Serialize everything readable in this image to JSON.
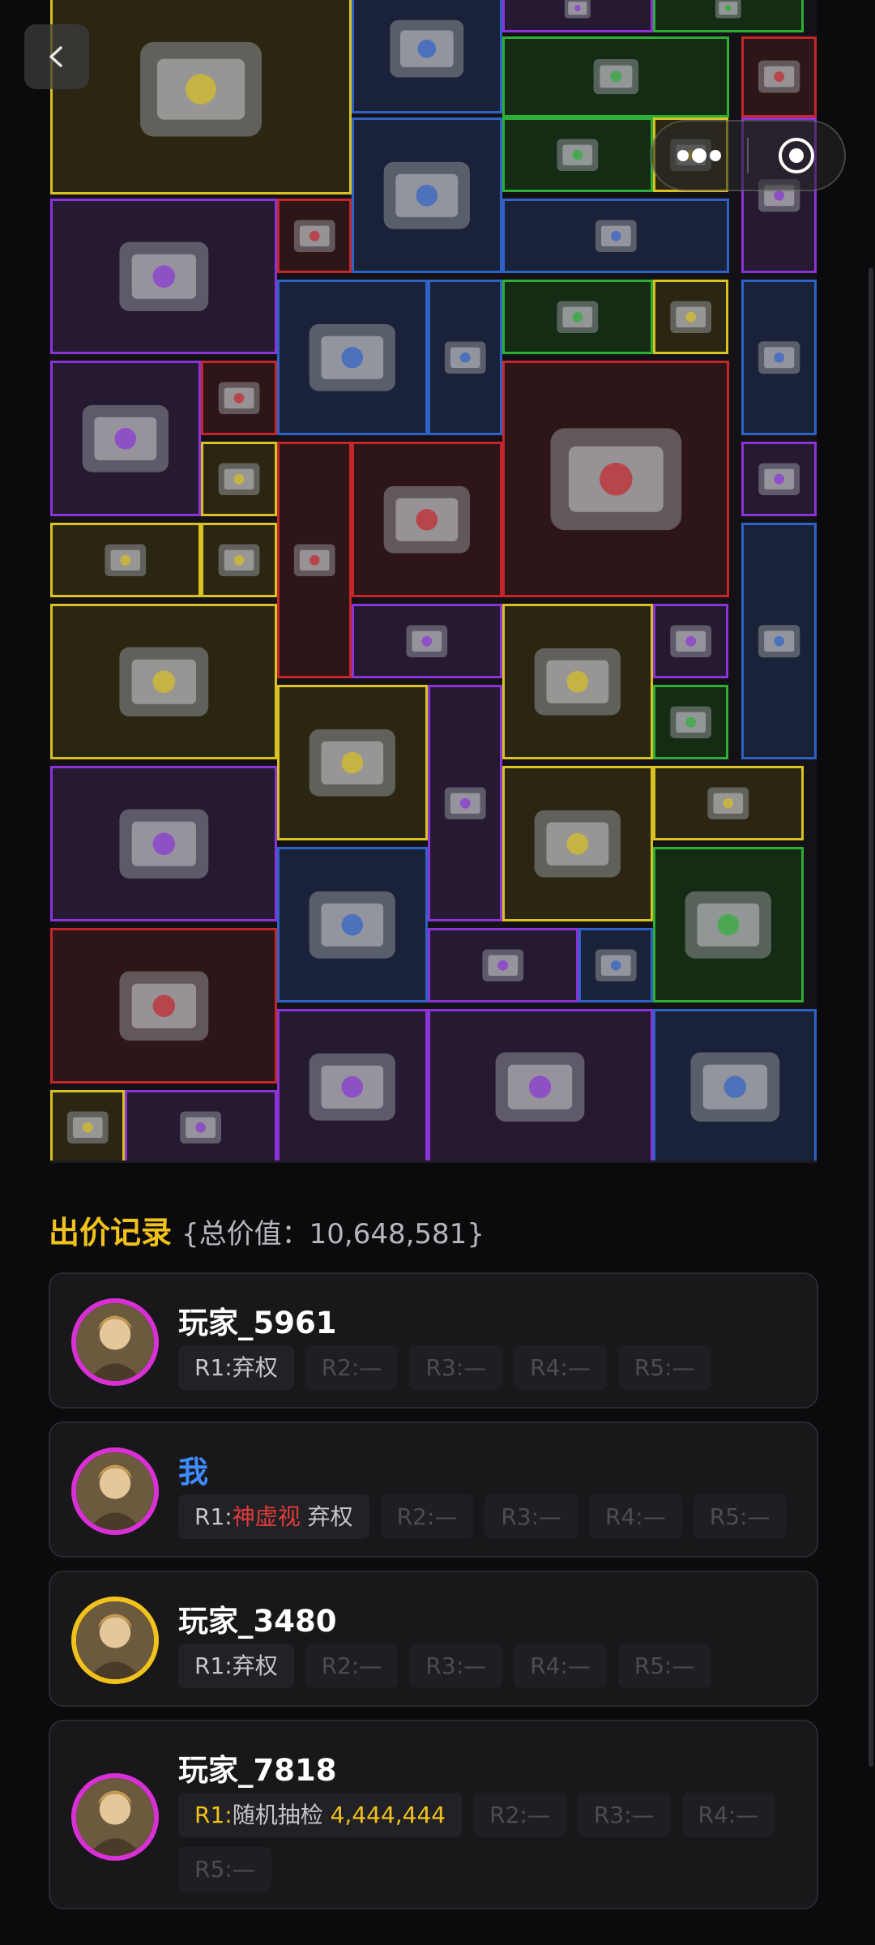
{
  "bid_section": {
    "title": "出价记录",
    "total_label": "{总价值：10,648,581}"
  },
  "records": [
    {
      "name": "玩家_5961",
      "name_color": "#ffffff",
      "avatar_ring": "#d930d6",
      "rounds": [
        {
          "label": "R1:",
          "text": "弃权",
          "dim": false
        },
        {
          "label": "R2:",
          "text": "—",
          "dim": true
        },
        {
          "label": "R3:",
          "text": "—",
          "dim": true
        },
        {
          "label": "R4:",
          "text": "—",
          "dim": true
        },
        {
          "label": "R5:",
          "text": "—",
          "dim": true
        }
      ]
    },
    {
      "name": "我",
      "name_color": "#3f8cff",
      "avatar_ring": "#d930d6",
      "rounds": [
        {
          "label": "R1:",
          "tool": "神虚视",
          "text": " 弃权",
          "dim": false
        },
        {
          "label": "R2:",
          "text": "—",
          "dim": true
        },
        {
          "label": "R3:",
          "text": "—",
          "dim": true
        },
        {
          "label": "R4:",
          "text": "—",
          "dim": true
        },
        {
          "label": "R5:",
          "text": "—",
          "dim": true
        }
      ]
    },
    {
      "name": "玩家_3480",
      "name_color": "#ffffff",
      "avatar_ring": "#f1c21b",
      "rounds": [
        {
          "label": "R1:",
          "text": "弃权",
          "dim": false
        },
        {
          "label": "R2:",
          "text": "—",
          "dim": true
        },
        {
          "label": "R3:",
          "text": "—",
          "dim": true
        },
        {
          "label": "R4:",
          "text": "—",
          "dim": true
        },
        {
          "label": "R5:",
          "text": "—",
          "dim": true
        }
      ]
    },
    {
      "name": "玩家_7818",
      "name_color": "#ffffff",
      "avatar_ring": "#d930d6",
      "rounds": [
        {
          "label": "R1:",
          "text": "随机抽检 ",
          "amount": "4,444,444",
          "dim": false,
          "gold_label": true
        },
        {
          "label": "R2:",
          "text": "—",
          "dim": true
        },
        {
          "label": "R3:",
          "text": "—",
          "dim": true
        },
        {
          "label": "R4:",
          "text": "—",
          "dim": true
        },
        {
          "label": "R5:",
          "text": "—",
          "dim": true
        }
      ]
    }
  ],
  "items": [
    {
      "name": "server-rack",
      "rarity": "gold"
    },
    {
      "name": "paint-can",
      "rarity": "blue"
    },
    {
      "name": "edc-kit-top",
      "rarity": "purple"
    },
    {
      "name": "cloth-item-top",
      "rarity": "green"
    },
    {
      "name": "sledgehammer",
      "rarity": "green"
    },
    {
      "name": "compass",
      "rarity": "red"
    },
    {
      "name": "power-drill",
      "rarity": "blue"
    },
    {
      "name": "old-map",
      "rarity": "green"
    },
    {
      "name": "hex-gadget",
      "rarity": "gold"
    },
    {
      "name": "hookah-vase",
      "rarity": "purple"
    },
    {
      "name": "hunting-knife",
      "rarity": "purple"
    },
    {
      "name": "usb-drive",
      "rarity": "red"
    },
    {
      "name": "hacksaw",
      "rarity": "blue"
    },
    {
      "name": "magazine",
      "rarity": "blue"
    },
    {
      "name": "coffee-maker",
      "rarity": "blue"
    },
    {
      "name": "wood-plank",
      "rarity": "green"
    },
    {
      "name": "power-bank",
      "rarity": "gold"
    },
    {
      "name": "spyglass",
      "rarity": "blue"
    },
    {
      "name": "hard-drive",
      "rarity": "purple"
    },
    {
      "name": "gold-watch",
      "rarity": "red"
    },
    {
      "name": "reactor-core",
      "rarity": "red"
    },
    {
      "name": "tin-box",
      "rarity": "gold"
    },
    {
      "name": "blueprint-tube",
      "rarity": "gold"
    },
    {
      "name": "gas-canister",
      "rarity": "red"
    },
    {
      "name": "gold-watch-2",
      "rarity": "red"
    },
    {
      "name": "stone",
      "rarity": "purple"
    },
    {
      "name": "gold-cup",
      "rarity": "gold"
    },
    {
      "name": "voice-recorder",
      "rarity": "blue"
    },
    {
      "name": "radio-station",
      "rarity": "gold"
    },
    {
      "name": "edc-kit",
      "rarity": "purple"
    },
    {
      "name": "camera",
      "rarity": "gold"
    },
    {
      "name": "toothbrush",
      "rarity": "purple"
    },
    {
      "name": "satellite-dish",
      "rarity": "gold"
    },
    {
      "name": "lantern",
      "rarity": "purple"
    },
    {
      "name": "vial",
      "rarity": "green"
    },
    {
      "name": "car-battery",
      "rarity": "purple"
    },
    {
      "name": "ammo-crate",
      "rarity": "gold"
    },
    {
      "name": "crossbow",
      "rarity": "gold"
    },
    {
      "name": "tablet-screen",
      "rarity": "blue"
    },
    {
      "name": "psu",
      "rarity": "green"
    },
    {
      "name": "laptop",
      "rarity": "red"
    },
    {
      "name": "old-radio",
      "rarity": "purple"
    },
    {
      "name": "memory-card",
      "rarity": "blue"
    },
    {
      "name": "motherboard",
      "rarity": "purple"
    },
    {
      "name": "car-battery-2",
      "rarity": "purple"
    },
    {
      "name": "camp-stove",
      "rarity": "blue"
    },
    {
      "name": "cola-bottle",
      "rarity": "gold"
    },
    {
      "name": "gpu-card",
      "rarity": "purple"
    }
  ]
}
